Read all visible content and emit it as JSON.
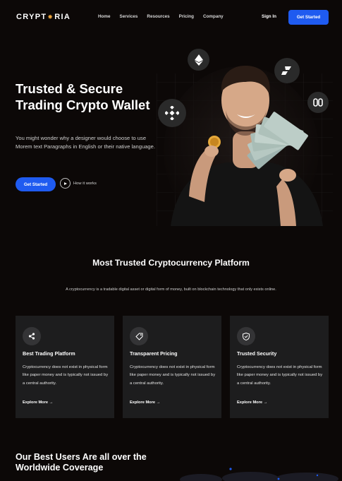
{
  "brand": {
    "name_left": "CRYPT",
    "name_right": "RIA"
  },
  "nav": {
    "items": [
      "Home",
      "Services",
      "Resources",
      "Pricing",
      "Company"
    ],
    "signin": "Sign In",
    "cta": "Get Started"
  },
  "hero": {
    "title": "Trusted & Secure Trading Crypto Wallet",
    "subtitle": "You might wonder why a designer would choose to use Morem text Paragraphs in English or their native language.",
    "cta": "Get Started",
    "secondary": "How it works"
  },
  "section": {
    "title": "Most Trusted Cryptocurrency Platform",
    "subtitle": "A cryptocurrency is a tradable digital asset or digital form of money, built on blockchain technology that only exists online."
  },
  "cards": [
    {
      "title": "Best Trading Platform",
      "text": "Cryptocurrency does not exist in physical form like paper money and is typically not issued by a central authority.",
      "link": "Explore More →",
      "icon": "share-icon"
    },
    {
      "title": "Transparent Pricing",
      "text": "Cryptocurrency does not exist in physical form like paper money and is typically not issued by a central authority.",
      "link": "Explore More →",
      "icon": "tag-icon"
    },
    {
      "title": "Trusted Security",
      "text": "Cryptocurrency does not exist in physical form like paper money and is typically not issued by a central authority.",
      "link": "Explore More →",
      "icon": "shield-icon"
    }
  ],
  "bottom": {
    "title": "Our Best Users Are all over the Worldwide Coverage"
  },
  "colors": {
    "bg": "#0c0807",
    "accent": "#1f5bf0",
    "card": "#1d1d1e",
    "star": "#e9a23b"
  },
  "hero_badges": [
    "ethereum-icon",
    "polkadot-icon",
    "binance-icon",
    "hedera-icon"
  ]
}
